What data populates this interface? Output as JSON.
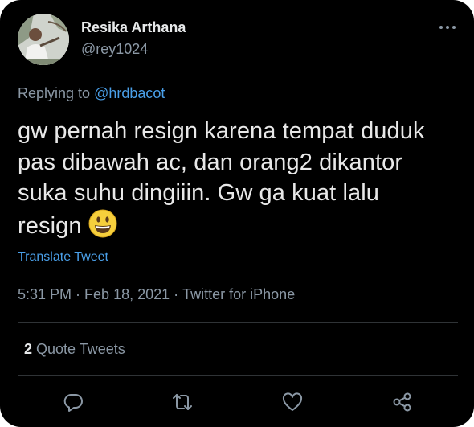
{
  "author": {
    "display_name": "Resika Arthana",
    "handle": "@rey1024"
  },
  "replying": {
    "prefix": "Replying to",
    "mention": "@hrdbacot"
  },
  "tweet": {
    "lines": [
      "gw pernah resign karena tempat duduk",
      "pas dibawah ac, dan orang2 dikantor",
      "suka suhu dingiiin. Gw ga kuat lalu",
      "resign"
    ],
    "emoji": "grinning-face"
  },
  "translate_label": "Translate Tweet",
  "meta": {
    "time": "5:31 PM",
    "dot": "·",
    "date": "Feb 18, 2021",
    "source": "Twitter for iPhone"
  },
  "stats": {
    "quote_count": "2",
    "quote_label": "Quote Tweets"
  },
  "actions": {
    "icons": [
      "reply-icon",
      "retweet-icon",
      "like-icon",
      "share-icon"
    ]
  },
  "colors": {
    "background": "#000000",
    "text": "#e7e9ea",
    "secondary": "#8b98a5",
    "link": "#4a9fe8",
    "divider": "#2f3336"
  }
}
